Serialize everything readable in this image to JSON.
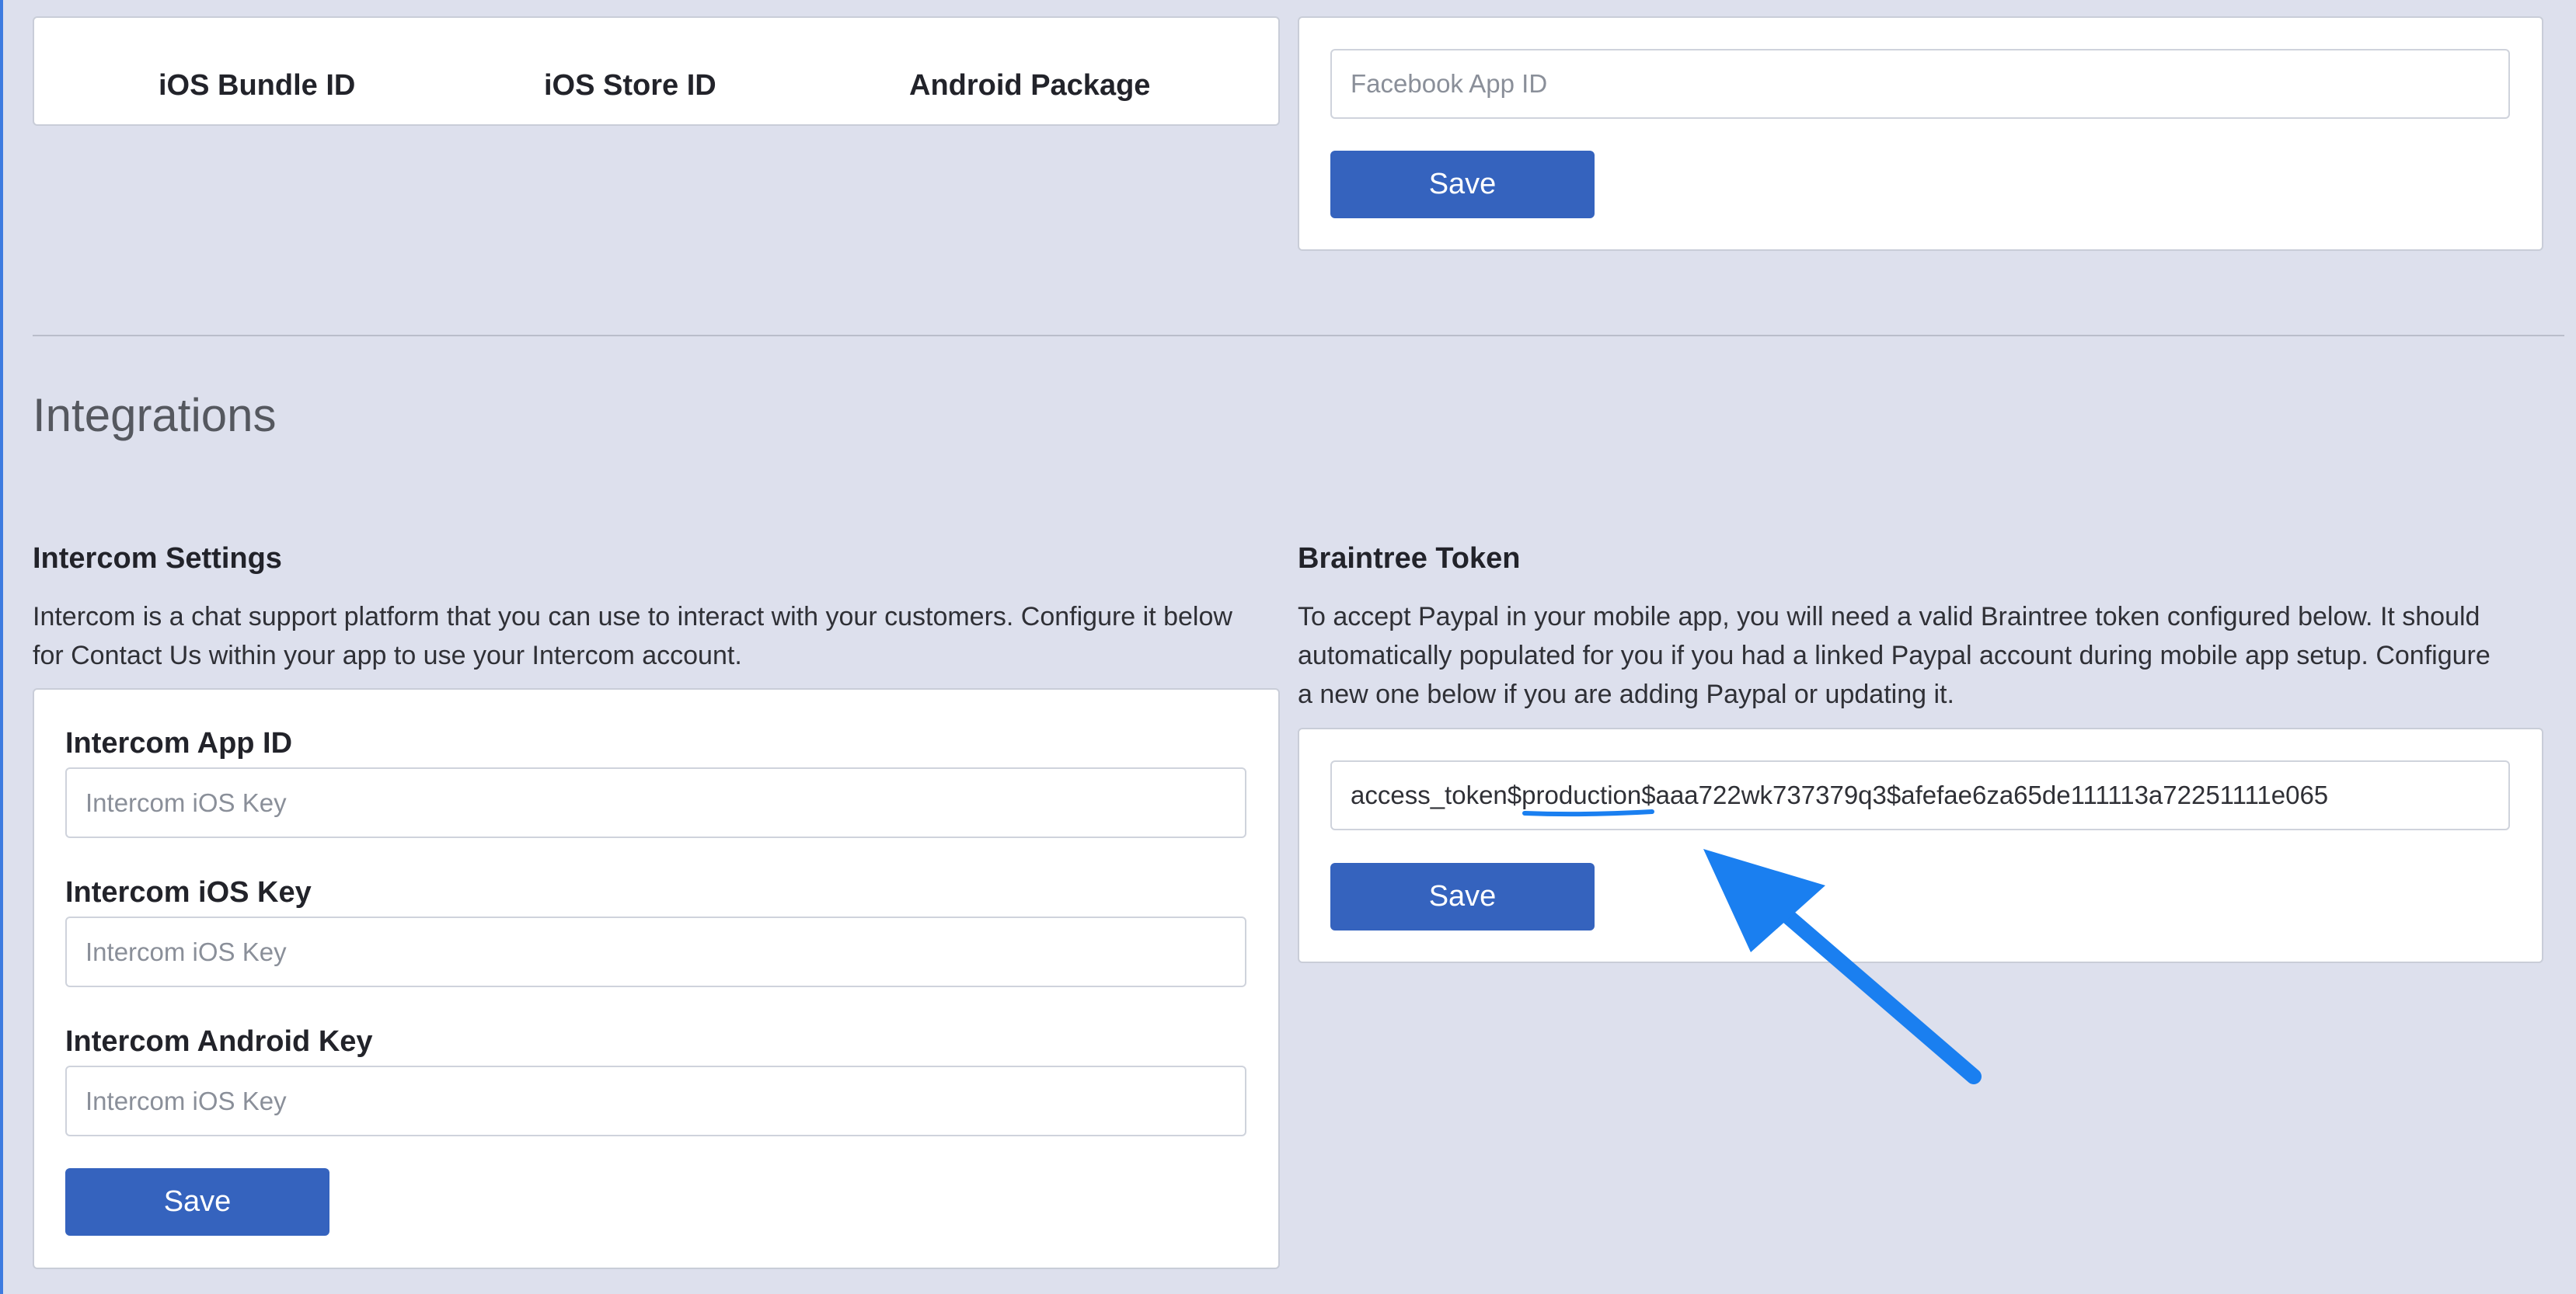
{
  "app_ids": {
    "columns": [
      "iOS Bundle ID",
      "iOS Store ID",
      "Android Package"
    ]
  },
  "facebook": {
    "placeholder": "Facebook App ID",
    "save_label": "Save"
  },
  "integrations": {
    "title": "Integrations",
    "intercom": {
      "heading": "Intercom Settings",
      "description_line1": "Intercom is a chat support platform that you can use to interact with your customers. Configure it below",
      "description_line2": "for Contact Us within your app to use your Intercom account.",
      "fields": [
        {
          "label": "Intercom App ID",
          "placeholder": "Intercom iOS Key"
        },
        {
          "label": "Intercom iOS Key",
          "placeholder": "Intercom iOS Key"
        },
        {
          "label": "Intercom Android Key",
          "placeholder": "Intercom iOS Key"
        }
      ],
      "save_label": "Save"
    },
    "braintree": {
      "heading": "Braintree Token",
      "description_line1": "To accept Paypal in your mobile app, you will need a valid Braintree token configured below. It should",
      "description_line2": "automatically populated for you if you had a linked Paypal account during mobile app setup. Configure",
      "description_line3": "a new one below if you are adding Paypal or updating it.",
      "token_prefix": "access_token$",
      "token_highlight": "production",
      "token_suffix": "$aaa722wk737379q3$afefae6za65de111113a72251111e065",
      "save_label": "Save"
    }
  },
  "colors": {
    "background": "#dde0ed",
    "button": "#3563be",
    "annotation": "#1a7ff0"
  }
}
